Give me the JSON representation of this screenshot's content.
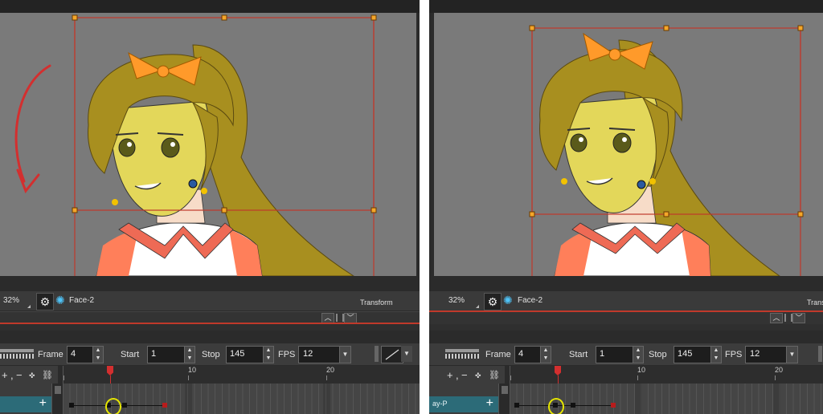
{
  "panels": [
    {
      "id": "left",
      "toolbar": {
        "zoom": "32%",
        "node": "Face-2",
        "mode": "Transform"
      },
      "controls": {
        "frame_label": "Frame",
        "frame_value": "4",
        "start_label": "Start",
        "start_value": "1",
        "stop_label": "Stop",
        "stop_value": "145",
        "fps_label": "FPS",
        "fps_value": "12"
      },
      "ruler": {
        "tick1": "10",
        "tick2": "20"
      },
      "layer": {
        "name": ""
      },
      "arrow_icon": "red-curved-arrow-icon"
    },
    {
      "id": "right",
      "toolbar": {
        "zoom": "32%",
        "node": "Face-2",
        "mode": "Transform"
      },
      "controls": {
        "frame_label": "Frame",
        "frame_value": "4",
        "start_label": "Start",
        "start_value": "1",
        "stop_label": "Stop",
        "stop_value": "145",
        "fps_label": "FPS",
        "fps_value": "12"
      },
      "ruler": {
        "tick1": "10",
        "tick2": "20"
      },
      "layer": {
        "name": "ay-P"
      }
    }
  ],
  "colors": {
    "viewport": "#7a7a7a",
    "bounding_box": "#c0392b",
    "selected_layer": "#2c6b78",
    "highlight": "#e6e600",
    "timeline_cursor": "#d32f2f"
  }
}
